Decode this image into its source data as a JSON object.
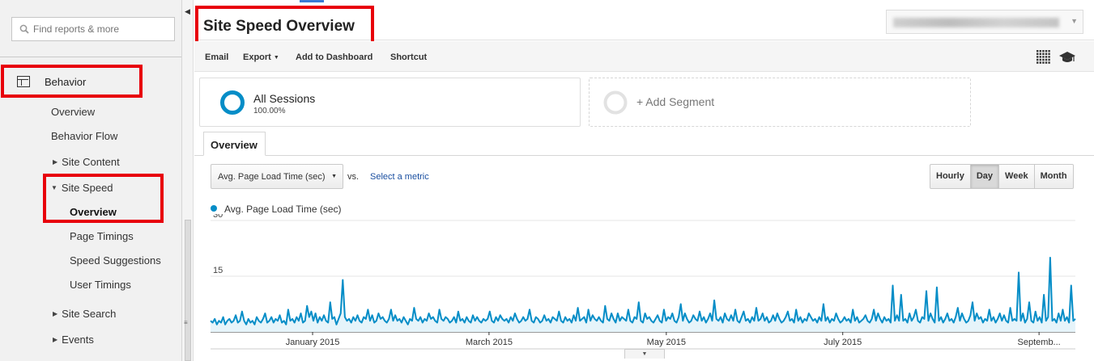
{
  "sidebar": {
    "search_placeholder": "Find reports & more",
    "section": "Behavior",
    "items": [
      {
        "label": "Overview"
      },
      {
        "label": "Behavior Flow"
      },
      {
        "label": "Site Content"
      },
      {
        "label": "Site Speed"
      },
      {
        "label": "Overview"
      },
      {
        "label": "Page Timings"
      },
      {
        "label": "Speed Suggestions"
      },
      {
        "label": "User Timings"
      },
      {
        "label": "Site Search"
      },
      {
        "label": "Events"
      }
    ]
  },
  "header": {
    "title": "Site Speed Overview"
  },
  "toolbar": {
    "email": "Email",
    "export": "Export",
    "add_to_dashboard": "Add to Dashboard",
    "shortcut": "Shortcut"
  },
  "segments": {
    "all_sessions": "All Sessions",
    "all_sessions_pct": "100.00%",
    "add_segment": "+ Add Segment"
  },
  "tabs": {
    "overview": "Overview"
  },
  "controls": {
    "metric": "Avg. Page Load Time (sec)",
    "vs": "vs.",
    "select_metric": "Select a metric",
    "granularity": [
      {
        "label": "Hourly",
        "active": false
      },
      {
        "label": "Day",
        "active": true
      },
      {
        "label": "Week",
        "active": false
      },
      {
        "label": "Month",
        "active": false
      }
    ]
  },
  "colors": {
    "series": "#058dc7",
    "series_fill": "#e6f4fa",
    "highlight": "#e8000b",
    "link": "#1a4fa0"
  },
  "chart_data": {
    "type": "area",
    "series": [
      {
        "name": "Avg. Page Load Time (sec)",
        "values": [
          3,
          2.5,
          3.5,
          2,
          3,
          2.5,
          4,
          2,
          3,
          3.5,
          2.5,
          3,
          4.5,
          2.5,
          3,
          5.5,
          3,
          2,
          3.5,
          2.5,
          3,
          2,
          4,
          3,
          2.5,
          3.5,
          5,
          2.5,
          3,
          4,
          2.5,
          3.5,
          3,
          4.5,
          2.5,
          3,
          2,
          6,
          3,
          3.5,
          2.5,
          4,
          3,
          5,
          2.5,
          3,
          7,
          4,
          5.5,
          3,
          5,
          2.5,
          4,
          3,
          4.5,
          3,
          2.5,
          8,
          3.5,
          4,
          2,
          3.5,
          5,
          14,
          4,
          3,
          3.5,
          2.5,
          4,
          3,
          4.5,
          3,
          2.5,
          4,
          3.5,
          6,
          3,
          4.5,
          2.5,
          3,
          5,
          3.5,
          4,
          3,
          2.5,
          3.5,
          6,
          3,
          4.5,
          3,
          3.5,
          2.5,
          4,
          3,
          2,
          3.5,
          3,
          6.5,
          3.5,
          3,
          4,
          2.5,
          3.5,
          3,
          5,
          3.5,
          4,
          3,
          2.5,
          6,
          3.5,
          3,
          4,
          3.5,
          2.5,
          3,
          4,
          2.5,
          5.5,
          3,
          3.5,
          2.5,
          4,
          3,
          2.5,
          4.5,
          3,
          4,
          3,
          2.5,
          3.5,
          3,
          3.5,
          5.5,
          3,
          2.5,
          4,
          3,
          4.5,
          3.5,
          3,
          3.5,
          2.5,
          4,
          3,
          5,
          3.5,
          2.5,
          3,
          4,
          3,
          3.5,
          6,
          3,
          2.5,
          4,
          3.5,
          2.5,
          3,
          4.5,
          3,
          3.5,
          2.5,
          4,
          3.5,
          3,
          5.5,
          3,
          2.5,
          4,
          3,
          3.5,
          2.5,
          4.5,
          3,
          6.5,
          3,
          3.5,
          4,
          2.5,
          6,
          3,
          4.5,
          3.5,
          3,
          4,
          3,
          2.5,
          7,
          3.5,
          3,
          5,
          3.5,
          2.5,
          5,
          3,
          4,
          3.5,
          3,
          6,
          3,
          2.5,
          4,
          3.5,
          8,
          3,
          2.5,
          5,
          3.5,
          4,
          3,
          2.5,
          3.5,
          4.5,
          3,
          2.5,
          6,
          3,
          4,
          3.5,
          5,
          3,
          2.5,
          4,
          7.5,
          3,
          5,
          3.5,
          2.5,
          3,
          4.5,
          3.5,
          3,
          5.5,
          3,
          4,
          2.5,
          3.5,
          5,
          3,
          8.5,
          3.5,
          3,
          4,
          2.5,
          5,
          3.5,
          3,
          4.5,
          3,
          6,
          3,
          2.5,
          4,
          5.5,
          3,
          3.5,
          2.5,
          4,
          3,
          6.5,
          3,
          3.5,
          5,
          3,
          4,
          2.5,
          3,
          4.5,
          3,
          5,
          3.5,
          2.5,
          3,
          4,
          5.5,
          3,
          3.5,
          2.5,
          6,
          3,
          4,
          2.5,
          3.5,
          3,
          5,
          4,
          3,
          3.5,
          2.5,
          4,
          3,
          7.5,
          3,
          4,
          2.5,
          3.5,
          3,
          5,
          3.5,
          2.5,
          3,
          4,
          3,
          3.5,
          2.5,
          6,
          3,
          4,
          2.5,
          3,
          3.5,
          4.5,
          3,
          2.5,
          3.5,
          6,
          3,
          5,
          3.5,
          2.5,
          4,
          3,
          3.5,
          2.5,
          12.5,
          3,
          4.5,
          3,
          10,
          3,
          3.5,
          2.5,
          5,
          3,
          4,
          6,
          3,
          2.5,
          4,
          3.5,
          11,
          3,
          5,
          3.5,
          2.5,
          12,
          3,
          4,
          2.5,
          3.5,
          5,
          3,
          3.5,
          2.5,
          4,
          6.5,
          3,
          5,
          3.5,
          2.5,
          3,
          4.5,
          8,
          3,
          5,
          3.5,
          4,
          2.5,
          3.5,
          3,
          6,
          3,
          4,
          2.5,
          3.5,
          5,
          3,
          4.5,
          3,
          2.5,
          6.5,
          3,
          3.5,
          3,
          16,
          3,
          5,
          2.5,
          3.5,
          8,
          3,
          2.5,
          5.5,
          3,
          4,
          2.5,
          10,
          3,
          4,
          20,
          3,
          3.5,
          2.5,
          5,
          3,
          6,
          3,
          4,
          2.5,
          12.5,
          3,
          3.5
        ]
      }
    ],
    "x_tick_labels": [
      "January 2015",
      "March 2015",
      "May 2015",
      "July 2015",
      "Septemb..."
    ],
    "y_tick_labels": [
      "30",
      "15"
    ],
    "ylim": [
      0,
      30
    ],
    "title": "",
    "xlabel": "",
    "ylabel": "",
    "grid": true
  }
}
